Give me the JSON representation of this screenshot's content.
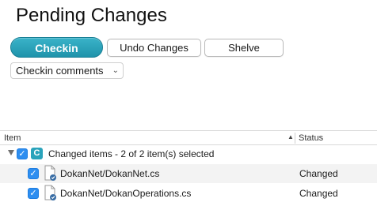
{
  "window": {
    "title": "Pending Changes"
  },
  "toolbar": {
    "checkin_label": "Checkin",
    "undo_label": "Undo Changes",
    "shelve_label": "Shelve"
  },
  "comments_dropdown": {
    "selected": "Checkin comments",
    "chevron_icon": "chevron-down-icon"
  },
  "table": {
    "columns": [
      "Item",
      "Status"
    ],
    "sort_icon": "sort-up-icon",
    "group": {
      "badge": "C",
      "label": "Changed items - 2 of 2 item(s) selected",
      "checked": true
    },
    "rows": [
      {
        "name": "DokanNet/DokanNet.cs",
        "status": "Changed",
        "checked": true
      },
      {
        "name": "DokanNet/DokanOperations.cs",
        "status": "Changed",
        "checked": true
      }
    ]
  },
  "colors": {
    "accent": "#2aa3bb",
    "checkbox": "#2e8ef0"
  }
}
